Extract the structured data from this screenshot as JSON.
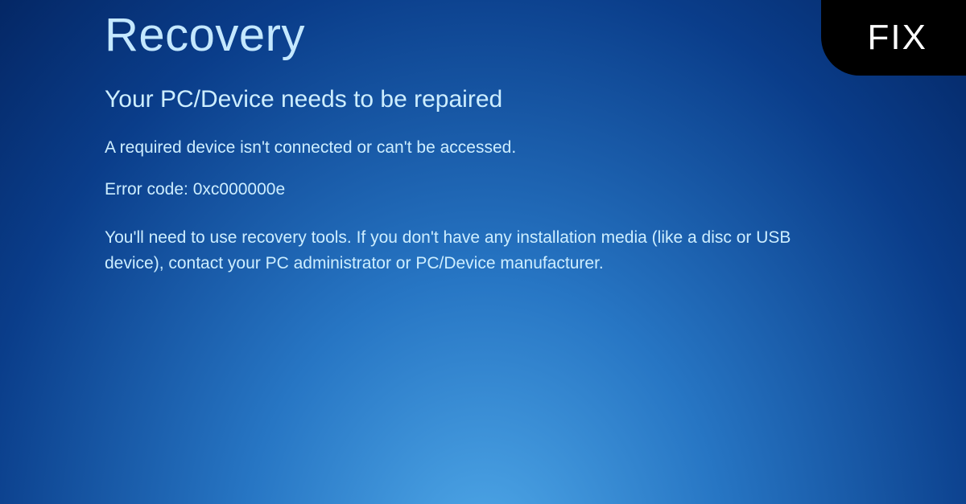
{
  "recovery": {
    "title": "Recovery",
    "subtitle": "Your PC/Device needs to be repaired",
    "message": "A required device isn't connected or can't be accessed.",
    "error_label": "Error code: 0xc000000e",
    "instructions": "You'll need to use recovery tools. If you don't have any installation media (like a disc or USB device), contact your PC administrator or PC/Device manufacturer."
  },
  "badge": {
    "label": "FIX"
  }
}
